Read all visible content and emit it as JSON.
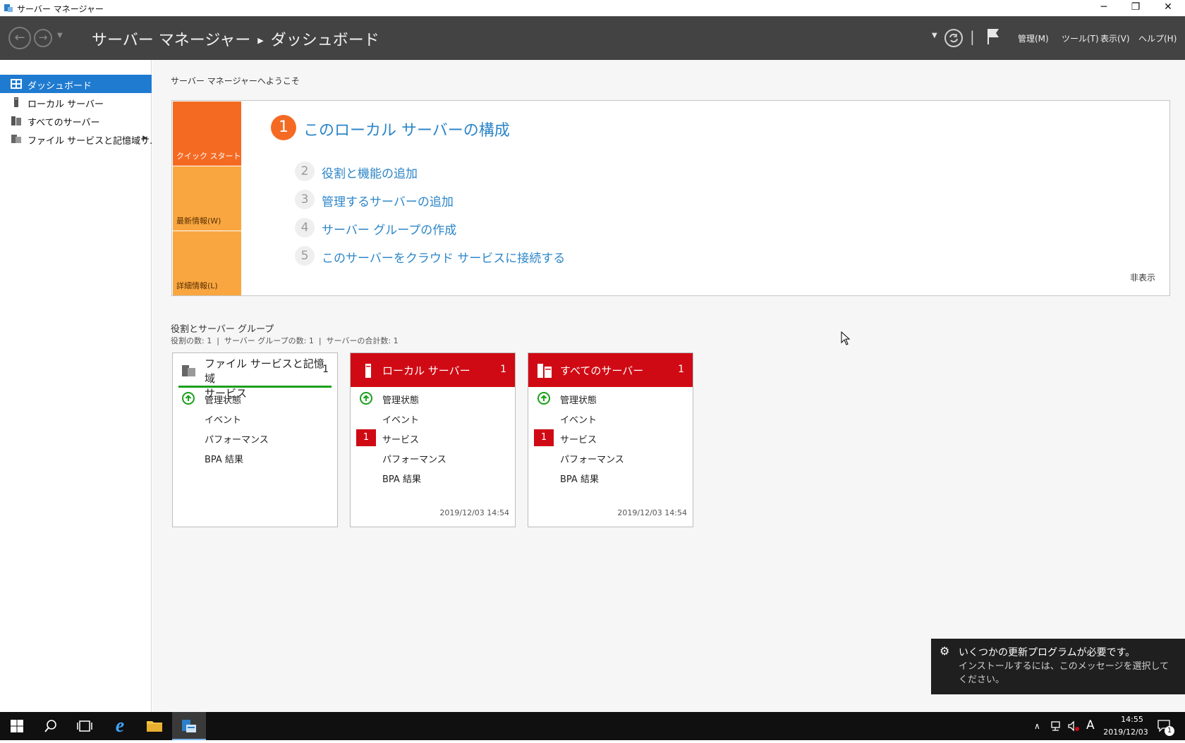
{
  "window": {
    "title": "サーバー マネージャー",
    "minimize_icon": "─",
    "restore_icon": "❐",
    "close_icon": "✕"
  },
  "header": {
    "breadcrumb_root": "サーバー マネージャー",
    "breadcrumb_sep": "▶",
    "breadcrumb_current": "ダッシュボード",
    "menus": [
      "管理(M)",
      "ツール(T)",
      "表示(V)",
      "ヘルプ(H)"
    ]
  },
  "sidebar": {
    "items": [
      {
        "label": "ダッシュボード",
        "icon": "dashboard-icon",
        "selected": true
      },
      {
        "label": "ローカル サーバー",
        "icon": "server-icon"
      },
      {
        "label": "すべてのサーバー",
        "icon": "servers-icon"
      },
      {
        "label": "ファイル サービスと記憶域サ...",
        "icon": "file-services-icon",
        "expand": "▶"
      }
    ]
  },
  "welcome": {
    "title": "サーバー マネージャーへようこそ",
    "tiles": [
      "クイック スタート(Q)",
      "最新情報(W)",
      "詳細情報(L)"
    ],
    "steps": [
      {
        "num": "1",
        "label": "このローカル サーバーの構成"
      },
      {
        "num": "2",
        "label": "役割と機能の追加"
      },
      {
        "num": "3",
        "label": "管理するサーバーの追加"
      },
      {
        "num": "4",
        "label": "サーバー グループの作成"
      },
      {
        "num": "5",
        "label": "このサーバーをクラウド サービスに接続する"
      }
    ],
    "hide": "非表示"
  },
  "roles": {
    "title": "役割とサーバー グループ",
    "summary": "役割の数: 1  |  サーバー グループの数: 1  |  サーバーの合計数: 1"
  },
  "cards": [
    {
      "title": "ファイル サービスと記憶域\nサービス",
      "count": "1",
      "rows": [
        "管理状態",
        "イベント",
        "パフォーマンス",
        "BPA 結果"
      ],
      "timestamp": ""
    },
    {
      "title": "ローカル サーバー",
      "count": "1",
      "rows": [
        "管理状態",
        "イベント",
        "サービス",
        "パフォーマンス",
        "BPA 結果"
      ],
      "service_badge": "1",
      "timestamp": "2019/12/03 14:54"
    },
    {
      "title": "すべてのサーバー",
      "count": "1",
      "rows": [
        "管理状態",
        "イベント",
        "サービス",
        "パフォーマンス",
        "BPA 結果"
      ],
      "service_badge": "1",
      "timestamp": "2019/12/03 14:54"
    }
  ],
  "toast": {
    "title": "いくつかの更新プログラムが必要です。",
    "body": "インストールするには、このメッセージを選択してください。"
  },
  "taskbar": {
    "ime": "A",
    "time": "14:55",
    "date": "2019/12/03",
    "notification_count": "1"
  },
  "colors": {
    "header": "#434343",
    "accent_blue": "#1f7bd0",
    "link_blue": "#2c86c8",
    "quickstart_orange": "#f56a22",
    "tile_orange": "#f9a640",
    "alert_red": "#d00a14",
    "ok_green": "#1aa01a"
  }
}
